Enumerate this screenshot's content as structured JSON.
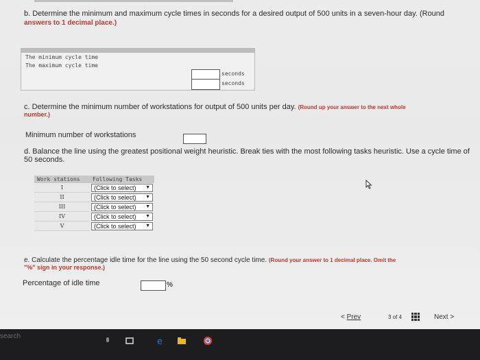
{
  "part_b": {
    "text": "b. Determine the minimum and maximum cycle times in seconds for a desired output of 500 units in a seven-hour day. (Round",
    "note": "answers to 1 decimal place.)",
    "rows": [
      {
        "label": "The minimum cycle time",
        "unit": "seconds"
      },
      {
        "label": "The maximum cycle time",
        "unit": "seconds"
      }
    ]
  },
  "part_c": {
    "text": "c. Determine the minimum number of workstations for output of 500 units per day.",
    "note_a": "(Round up your answer to the next whole",
    "note_b": "number.)",
    "field_label": "Minimum number of workstations"
  },
  "part_d": {
    "text": "d. Balance the line using the greatest positional weight heuristic. Break ties with the most following tasks heuristic. Use a cycle time of",
    "text2": "50 seconds.",
    "col_workstations": "Work stations",
    "col_tasks": "Following Tasks",
    "stations": [
      "I",
      "II",
      "III",
      "IV",
      "V"
    ],
    "select_placeholder": "(Click to select)"
  },
  "part_e": {
    "text": "e. Calculate the percentage idle time for the line using the 50 second cycle time.",
    "note_a": "(Round your answer to 1 decimal place. Omit the",
    "note_b": "\"%\" sign in your response.)",
    "field_label": "Percentage of idle time",
    "unit": "%"
  },
  "nav": {
    "prev": "Prev",
    "page_current": "3",
    "page_of": "of",
    "page_total": "4",
    "next": "Next"
  },
  "taskbar": {
    "search": "search"
  }
}
